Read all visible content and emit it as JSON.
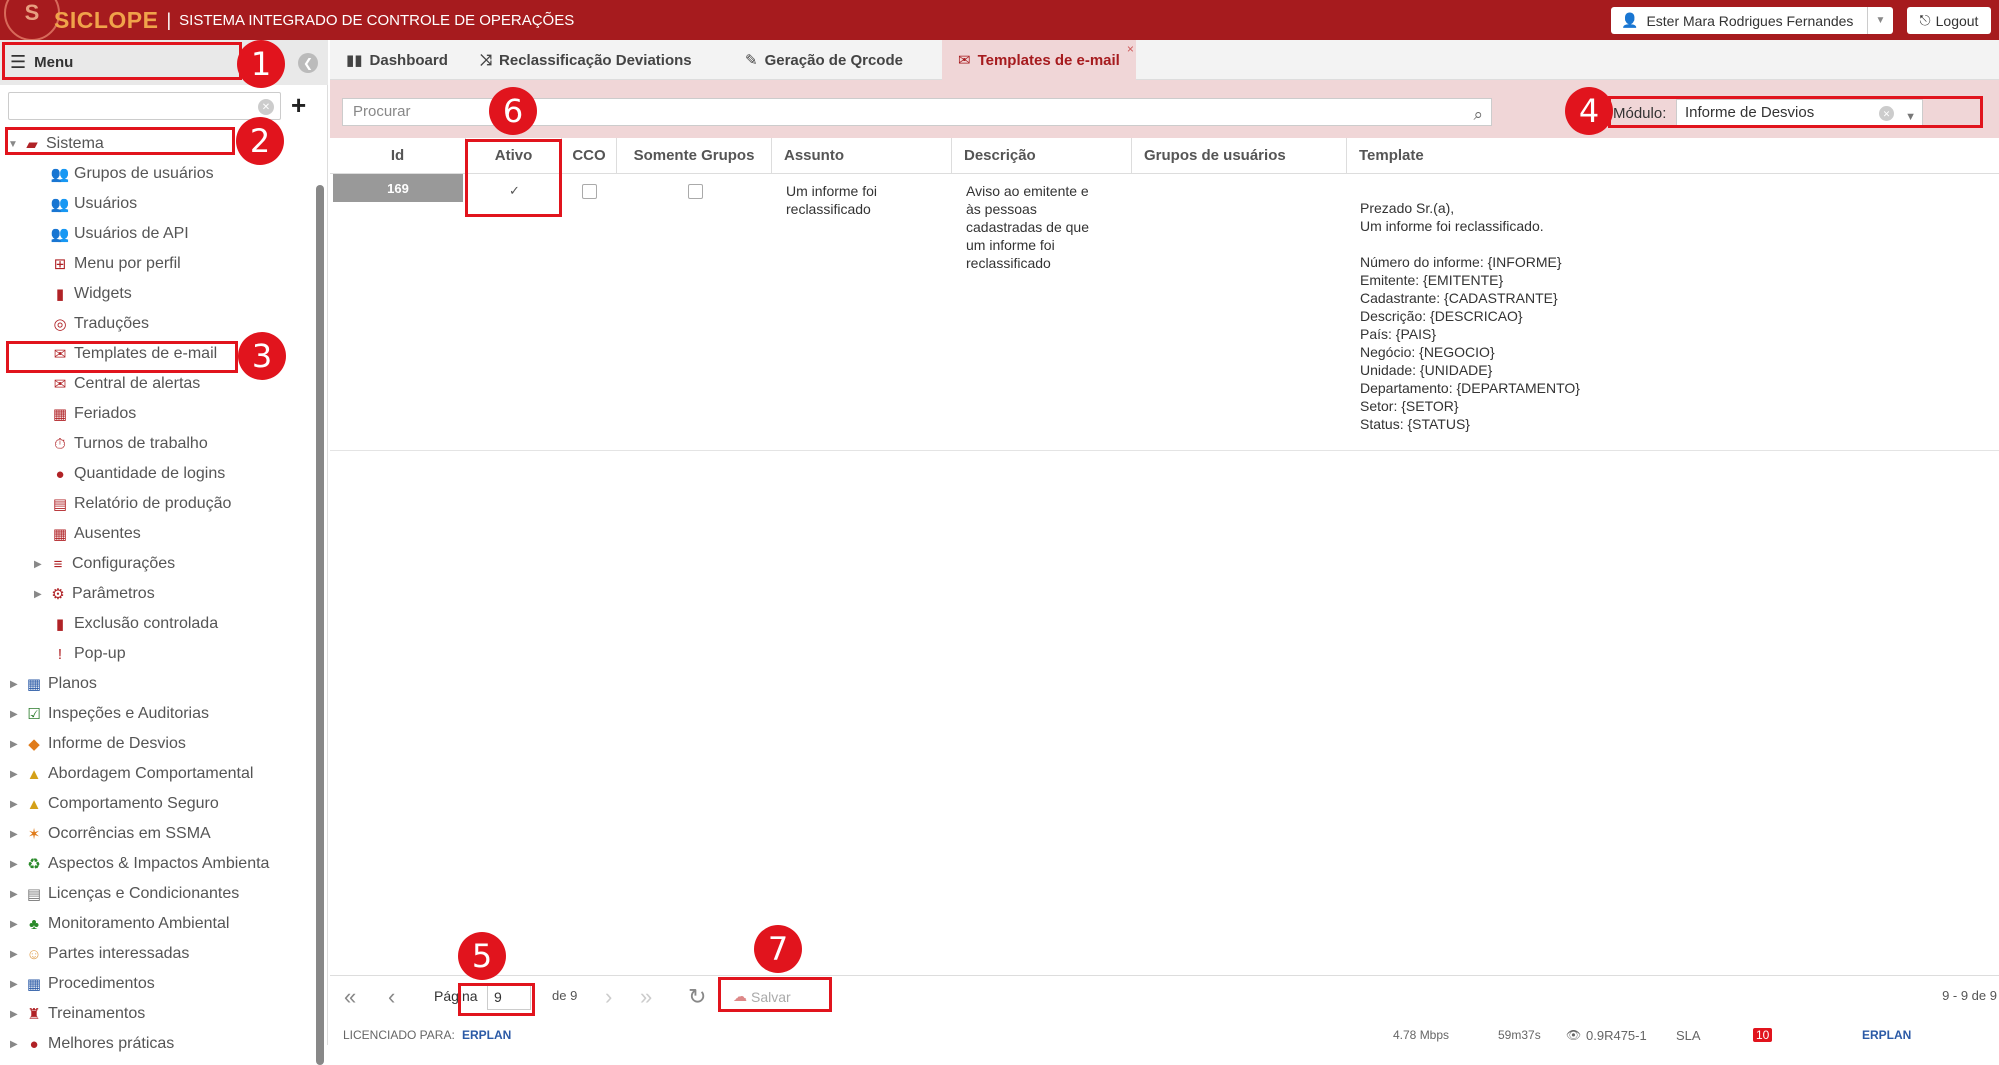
{
  "app": {
    "brand": "SICLOPE",
    "system_title": "SISTEMA INTEGRADO DE CONTROLE DE OPERAÇÕES",
    "user_name": "Ester Mara Rodrigues Fernandes",
    "logout_label": "Logout"
  },
  "sidebar": {
    "menu_label": "Menu",
    "items": [
      {
        "label": "Sistema"
      },
      {
        "label": "Grupos de usuários"
      },
      {
        "label": "Usuários"
      },
      {
        "label": "Usuários de API"
      },
      {
        "label": "Menu por perfil"
      },
      {
        "label": "Widgets"
      },
      {
        "label": "Traduções"
      },
      {
        "label": "Templates de e-mail"
      },
      {
        "label": "Central de alertas"
      },
      {
        "label": "Feriados"
      },
      {
        "label": "Turnos de trabalho"
      },
      {
        "label": "Quantidade de logins"
      },
      {
        "label": "Relatório de produção"
      },
      {
        "label": "Ausentes"
      },
      {
        "label": "Configurações"
      },
      {
        "label": "Parâmetros"
      },
      {
        "label": "Exclusão controlada"
      },
      {
        "label": "Pop-up"
      },
      {
        "label": "Planos"
      },
      {
        "label": "Inspeções e Auditorias"
      },
      {
        "label": "Informe de Desvios"
      },
      {
        "label": "Abordagem Comportamental"
      },
      {
        "label": "Comportamento Seguro"
      },
      {
        "label": "Ocorrências em SSMA"
      },
      {
        "label": "Aspectos & Impactos Ambienta"
      },
      {
        "label": "Licenças e Condicionantes"
      },
      {
        "label": "Monitoramento Ambiental"
      },
      {
        "label": "Partes interessadas"
      },
      {
        "label": "Procedimentos"
      },
      {
        "label": "Treinamentos"
      },
      {
        "label": "Melhores práticas"
      }
    ]
  },
  "tabs": [
    {
      "label": "Dashboard"
    },
    {
      "label": "Reclassificação Deviations"
    },
    {
      "label": "Geração de Qrcode"
    },
    {
      "label": "Templates de e-mail"
    }
  ],
  "toolbar": {
    "search_placeholder": "Procurar",
    "modulo_label": "Módulo:",
    "modulo_value": "Informe de Desvios"
  },
  "grid": {
    "columns": [
      "Id",
      "Ativo",
      "CCO",
      "Somente Grupos",
      "Assunto",
      "Descrição",
      "Grupos de usuários",
      "Template"
    ],
    "rows": [
      {
        "id": "169",
        "ativo": true,
        "cco": false,
        "somente_grupos": false,
        "assunto": "Um informe foi\nreclassificado",
        "descricao": "Aviso ao emitente e\nàs pessoas\ncadastradas de que\num informe foi\nreclassificado",
        "grupos": "",
        "template": "Prezado Sr.(a),\nUm informe foi reclassificado.\n\nNúmero do informe: {INFORME}\nEmitente: {EMITENTE}\nCadastrante: {CADASTRANTE}\nDescrição: {DESCRICAO}\nPaís: {PAIS}\nNegócio: {NEGOCIO}\nUnidade: {UNIDADE}\nDepartamento: {DEPARTAMENTO}\nSetor: {SETOR}\nStatus: {STATUS}"
      }
    ]
  },
  "pagination": {
    "page_label": "Página",
    "page_value": "9",
    "of_label": "de 9",
    "save_label": "Salvar",
    "count_label": "9 - 9 de 9"
  },
  "status_bar": {
    "licensed_label": "LICENCIADO PARA:",
    "brand2": "ERPLAN",
    "speed": "4.78 Mbps",
    "timer": "59m37s",
    "version": "0.9R475-1",
    "sla": "SLA",
    "notif_count": "10"
  },
  "annotations": [
    "1",
    "2",
    "3",
    "4",
    "5",
    "6",
    "7"
  ],
  "colors": {
    "brand_red": "#a61b1e",
    "highlight_red": "#e1141d",
    "tab_active_bg": "#f0d6d7"
  }
}
